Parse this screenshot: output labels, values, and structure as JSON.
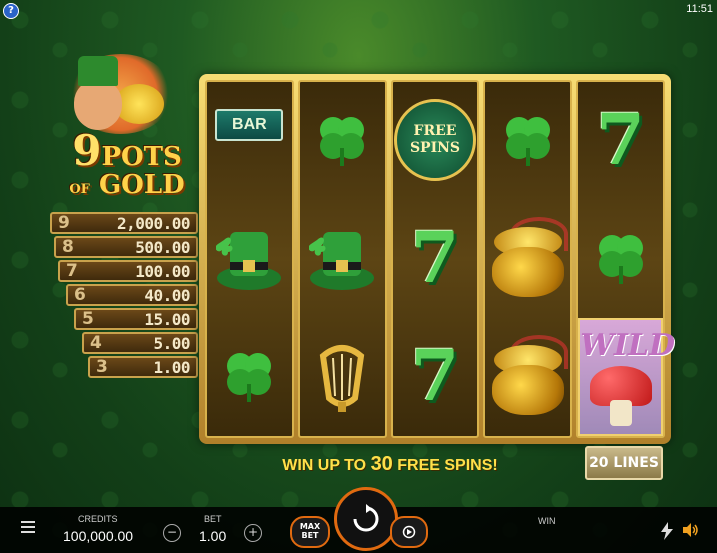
{
  "status": {
    "time": "11:51"
  },
  "help_label": "?",
  "logo": {
    "line1": "9",
    "line2": "POTS",
    "line3": "OF",
    "line4": "GOLD"
  },
  "paytable": [
    {
      "count": "9",
      "value": "2,000.00"
    },
    {
      "count": "8",
      "value": "500.00"
    },
    {
      "count": "7",
      "value": "100.00"
    },
    {
      "count": "6",
      "value": "40.00"
    },
    {
      "count": "5",
      "value": "15.00"
    },
    {
      "count": "4",
      "value": "5.00"
    },
    {
      "count": "3",
      "value": "1.00"
    }
  ],
  "reels": [
    [
      "bar",
      "leprechaun-hat",
      "clover"
    ],
    [
      "clover",
      "leprechaun-hat",
      "harp"
    ],
    [
      "free-spins",
      "seven",
      "seven"
    ],
    [
      "clover",
      "pot-of-gold",
      "pot-of-gold"
    ],
    [
      "seven",
      "clover",
      "wild"
    ]
  ],
  "symbols": {
    "bar_label": "BAR",
    "free_line1": "FREE",
    "free_line2": "SPINS",
    "wild_label": "WILD",
    "seven_label": "7"
  },
  "promo": {
    "prefix": "WIN UP TO",
    "number": "30",
    "suffix": "FREE SPINS!"
  },
  "lines": "20 LINES",
  "bottom": {
    "credits_label": "CREDITS",
    "credits_value": "100,000.00",
    "bet_label": "BET",
    "bet_value": "1.00",
    "minus": "−",
    "plus": "+",
    "max_bet": "MAX BET",
    "win_label": "WIN"
  },
  "colors": {
    "accent": "#e06a10",
    "gold": "#ffe04a",
    "felt": "#1f5a22"
  }
}
